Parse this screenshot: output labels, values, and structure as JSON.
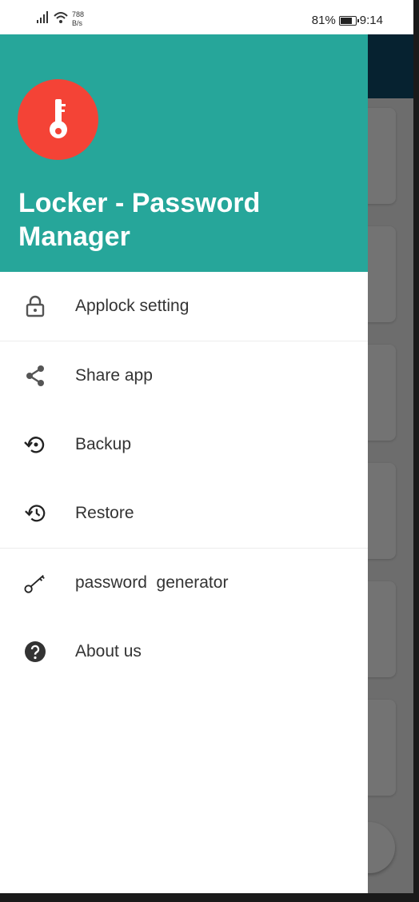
{
  "status_bar": {
    "net_speed_value": "788",
    "net_speed_unit": "B/s",
    "battery_percent": "81%",
    "battery_level": 0.81,
    "time": "9:14"
  },
  "drawer": {
    "header": {
      "title": "Locker - Password Manager",
      "header_color": "#26a69a",
      "logo_color": "#f44336",
      "logo_icon": "key-icon"
    },
    "menu_items": [
      {
        "label": "Applock setting",
        "icon": "lock-icon"
      },
      {
        "label": "Share app",
        "icon": "share-icon"
      },
      {
        "label": "Backup",
        "icon": "backup-icon"
      },
      {
        "label": "Restore",
        "icon": "restore-icon"
      },
      {
        "label": "password  generator",
        "icon": "key-icon"
      },
      {
        "label": "About us",
        "icon": "help-icon"
      }
    ]
  }
}
